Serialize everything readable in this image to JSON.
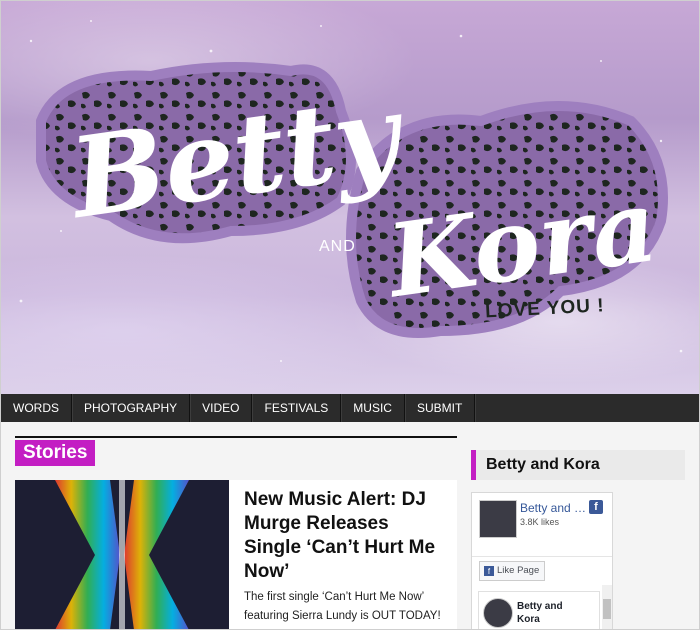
{
  "banner": {
    "logo_text_line1": "Betty",
    "logo_text_and": "AND",
    "logo_text_line2": "Kora",
    "tagline": "LOVE YOU !"
  },
  "nav": {
    "items": [
      {
        "label": "WORDS"
      },
      {
        "label": "PHOTOGRAPHY"
      },
      {
        "label": "VIDEO"
      },
      {
        "label": "FESTIVALS"
      },
      {
        "label": "MUSIC"
      },
      {
        "label": "SUBMIT"
      }
    ]
  },
  "main": {
    "section_label": "Stories",
    "post": {
      "title": "New Music Alert: DJ Murge Releases Single ‘Can’t Hurt Me Now’",
      "excerpt": "The first single ‘Can’t Hurt Me Now’ featuring Sierra Lundy is OUT TODAY!"
    }
  },
  "sidebar": {
    "title": "Betty and Kora",
    "facebook": {
      "page_name": "Betty and Kora",
      "likes": "3.8K likes",
      "like_button": "Like Page",
      "post_author": "Betty and Kora"
    }
  },
  "colors": {
    "accent": "#c31ec3",
    "nav_bg": "#2b2b2b",
    "facebook_blue": "#3b5998"
  }
}
